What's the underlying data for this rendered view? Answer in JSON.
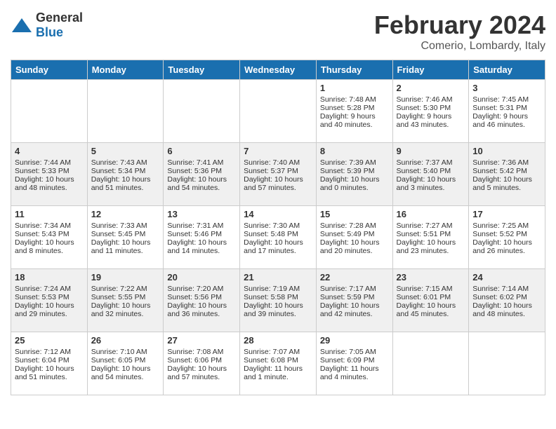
{
  "logo": {
    "general": "General",
    "blue": "Blue"
  },
  "title": "February 2024",
  "location": "Comerio, Lombardy, Italy",
  "days_of_week": [
    "Sunday",
    "Monday",
    "Tuesday",
    "Wednesday",
    "Thursday",
    "Friday",
    "Saturday"
  ],
  "weeks": [
    [
      {
        "day": "",
        "info": ""
      },
      {
        "day": "",
        "info": ""
      },
      {
        "day": "",
        "info": ""
      },
      {
        "day": "",
        "info": ""
      },
      {
        "day": "1",
        "sunrise": "7:48 AM",
        "sunset": "5:28 PM",
        "daylight": "9 hours and 40 minutes."
      },
      {
        "day": "2",
        "sunrise": "7:46 AM",
        "sunset": "5:30 PM",
        "daylight": "9 hours and 43 minutes."
      },
      {
        "day": "3",
        "sunrise": "7:45 AM",
        "sunset": "5:31 PM",
        "daylight": "9 hours and 46 minutes."
      }
    ],
    [
      {
        "day": "4",
        "sunrise": "7:44 AM",
        "sunset": "5:33 PM",
        "daylight": "10 hours and 48 minutes."
      },
      {
        "day": "5",
        "sunrise": "7:43 AM",
        "sunset": "5:34 PM",
        "daylight": "10 hours and 51 minutes."
      },
      {
        "day": "6",
        "sunrise": "7:41 AM",
        "sunset": "5:36 PM",
        "daylight": "10 hours and 54 minutes."
      },
      {
        "day": "7",
        "sunrise": "7:40 AM",
        "sunset": "5:37 PM",
        "daylight": "10 hours and 57 minutes."
      },
      {
        "day": "8",
        "sunrise": "7:39 AM",
        "sunset": "5:39 PM",
        "daylight": "10 hours and 0 minutes."
      },
      {
        "day": "9",
        "sunrise": "7:37 AM",
        "sunset": "5:40 PM",
        "daylight": "10 hours and 3 minutes."
      },
      {
        "day": "10",
        "sunrise": "7:36 AM",
        "sunset": "5:42 PM",
        "daylight": "10 hours and 5 minutes."
      }
    ],
    [
      {
        "day": "11",
        "sunrise": "7:34 AM",
        "sunset": "5:43 PM",
        "daylight": "10 hours and 8 minutes."
      },
      {
        "day": "12",
        "sunrise": "7:33 AM",
        "sunset": "5:45 PM",
        "daylight": "10 hours and 11 minutes."
      },
      {
        "day": "13",
        "sunrise": "7:31 AM",
        "sunset": "5:46 PM",
        "daylight": "10 hours and 14 minutes."
      },
      {
        "day": "14",
        "sunrise": "7:30 AM",
        "sunset": "5:48 PM",
        "daylight": "10 hours and 17 minutes."
      },
      {
        "day": "15",
        "sunrise": "7:28 AM",
        "sunset": "5:49 PM",
        "daylight": "10 hours and 20 minutes."
      },
      {
        "day": "16",
        "sunrise": "7:27 AM",
        "sunset": "5:51 PM",
        "daylight": "10 hours and 23 minutes."
      },
      {
        "day": "17",
        "sunrise": "7:25 AM",
        "sunset": "5:52 PM",
        "daylight": "10 hours and 26 minutes."
      }
    ],
    [
      {
        "day": "18",
        "sunrise": "7:24 AM",
        "sunset": "5:53 PM",
        "daylight": "10 hours and 29 minutes."
      },
      {
        "day": "19",
        "sunrise": "7:22 AM",
        "sunset": "5:55 PM",
        "daylight": "10 hours and 32 minutes."
      },
      {
        "day": "20",
        "sunrise": "7:20 AM",
        "sunset": "5:56 PM",
        "daylight": "10 hours and 36 minutes."
      },
      {
        "day": "21",
        "sunrise": "7:19 AM",
        "sunset": "5:58 PM",
        "daylight": "10 hours and 39 minutes."
      },
      {
        "day": "22",
        "sunrise": "7:17 AM",
        "sunset": "5:59 PM",
        "daylight": "10 hours and 42 minutes."
      },
      {
        "day": "23",
        "sunrise": "7:15 AM",
        "sunset": "6:01 PM",
        "daylight": "10 hours and 45 minutes."
      },
      {
        "day": "24",
        "sunrise": "7:14 AM",
        "sunset": "6:02 PM",
        "daylight": "10 hours and 48 minutes."
      }
    ],
    [
      {
        "day": "25",
        "sunrise": "7:12 AM",
        "sunset": "6:04 PM",
        "daylight": "10 hours and 51 minutes."
      },
      {
        "day": "26",
        "sunrise": "7:10 AM",
        "sunset": "6:05 PM",
        "daylight": "10 hours and 54 minutes."
      },
      {
        "day": "27",
        "sunrise": "7:08 AM",
        "sunset": "6:06 PM",
        "daylight": "10 hours and 57 minutes."
      },
      {
        "day": "28",
        "sunrise": "7:07 AM",
        "sunset": "6:08 PM",
        "daylight": "11 hours and 1 minute."
      },
      {
        "day": "29",
        "sunrise": "7:05 AM",
        "sunset": "6:09 PM",
        "daylight": "11 hours and 4 minutes."
      },
      {
        "day": "",
        "info": ""
      },
      {
        "day": "",
        "info": ""
      }
    ]
  ],
  "labels": {
    "sunrise_prefix": "Sunrise: ",
    "sunset_prefix": "Sunset: ",
    "daylight_prefix": "Daylight: "
  }
}
